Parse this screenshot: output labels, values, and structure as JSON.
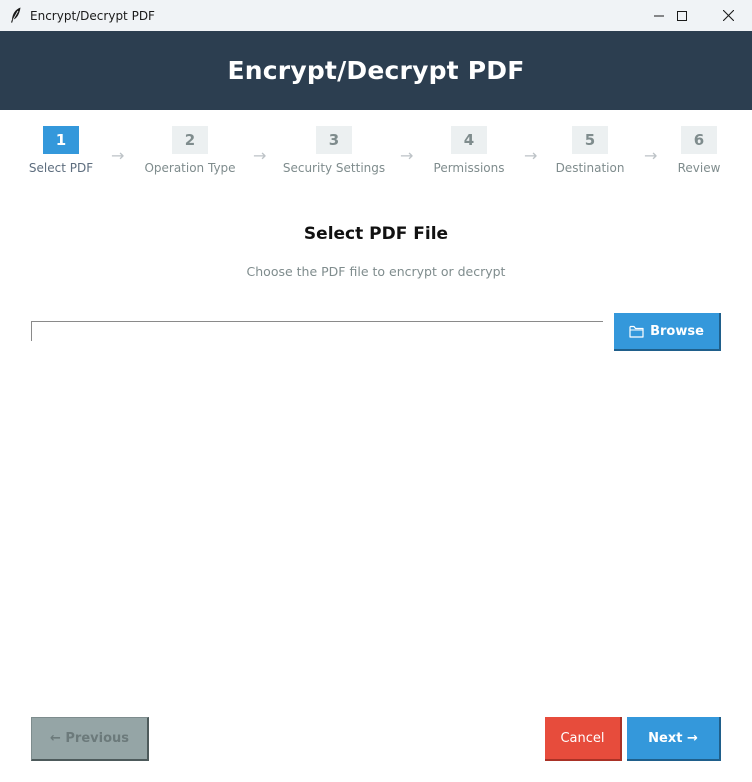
{
  "window": {
    "title": "Encrypt/Decrypt PDF",
    "icon": "feather-icon",
    "controls": [
      "minimize-icon",
      "maximize-icon",
      "close-icon"
    ]
  },
  "header": {
    "title": "Encrypt/Decrypt PDF"
  },
  "steps": [
    {
      "number": "1",
      "label": "Select PDF",
      "active": true
    },
    {
      "number": "2",
      "label": "Operation Type",
      "active": false
    },
    {
      "number": "3",
      "label": "Security Settings",
      "active": false
    },
    {
      "number": "4",
      "label": "Permissions",
      "active": false
    },
    {
      "number": "5",
      "label": "Destination",
      "active": false
    },
    {
      "number": "6",
      "label": "Review",
      "active": false
    }
  ],
  "step_arrow": "→",
  "section": {
    "title": "Select PDF File",
    "subtitle": "Choose the PDF file to encrypt or decrypt"
  },
  "file_input": {
    "value": "",
    "placeholder": ""
  },
  "browse_button": {
    "label": "Browse",
    "icon": "folder-icon"
  },
  "footer": {
    "previous_label": "← Previous",
    "cancel_label": "Cancel",
    "next_label": "Next →"
  },
  "colors": {
    "header_bg": "#2c3e50",
    "accent": "#3498db",
    "danger": "#e74c3c",
    "disabled": "#95a5a6",
    "step_inactive_bg": "#ecf0f1",
    "muted_text": "#7f8c8d"
  }
}
